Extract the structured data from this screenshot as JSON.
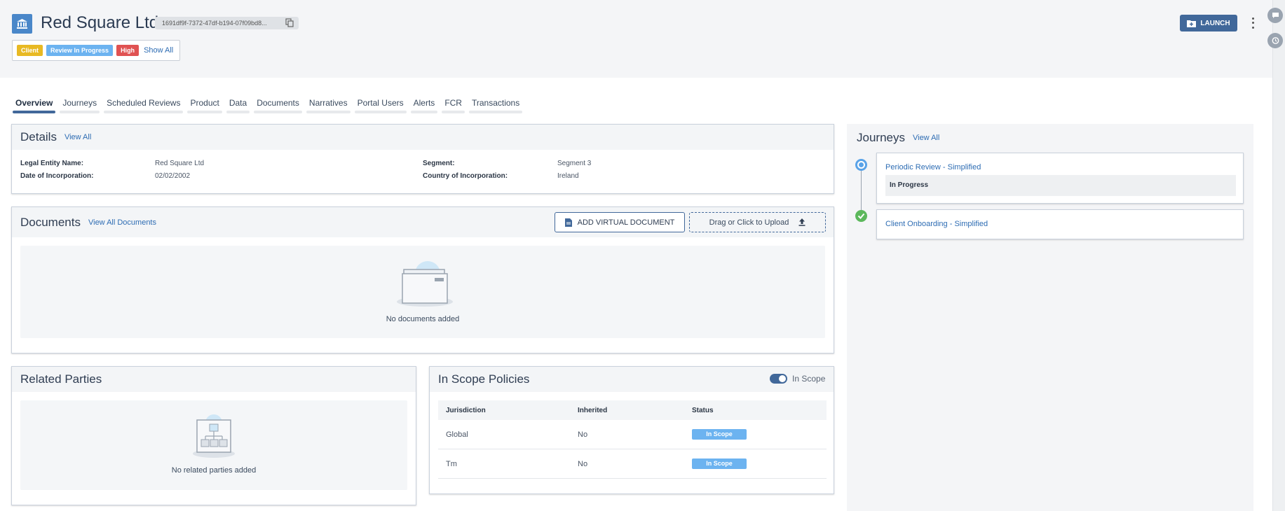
{
  "header": {
    "entity_name": "Red Square Ltd",
    "entity_id": "1691df9f-7372-47df-b194-07f09bd8...",
    "tags": [
      {
        "label": "Client",
        "color": "#e8b923"
      },
      {
        "label": "Review In Progress",
        "color": "#6cb3f0"
      },
      {
        "label": "High",
        "color": "#e05252"
      }
    ],
    "show_all": "Show All",
    "launch_label": "LAUNCH"
  },
  "tabs": [
    "Overview",
    "Journeys",
    "Scheduled Reviews",
    "Product",
    "Data",
    "Documents",
    "Narratives",
    "Portal Users",
    "Alerts",
    "FCR",
    "Transactions"
  ],
  "details": {
    "title": "Details",
    "view_all": "View All",
    "legal_entity_name_label": "Legal Entity Name:",
    "legal_entity_name": "Red Square Ltd",
    "date_of_incorporation_label": "Date of Incorporation:",
    "date_of_incorporation": "02/02/2002",
    "segment_label": "Segment:",
    "segment": "Segment 3",
    "country_label": "Country of Incorporation:",
    "country": "Ireland"
  },
  "documents": {
    "title": "Documents",
    "view_all": "View All Documents",
    "add_virtual": "ADD VIRTUAL DOCUMENT",
    "upload": "Drag or Click to Upload",
    "empty": "No documents added"
  },
  "related_parties": {
    "title": "Related Parties",
    "empty": "No related parties added"
  },
  "policies": {
    "title": "In Scope Policies",
    "toggle_label": "In Scope",
    "columns": [
      "Jurisdiction",
      "Inherited",
      "Status"
    ],
    "rows": [
      {
        "jurisdiction": "Global",
        "inherited": "No",
        "status": "In Scope"
      },
      {
        "jurisdiction": "Tm",
        "inherited": "No",
        "status": "In Scope"
      }
    ]
  },
  "journeys": {
    "title": "Journeys",
    "view_all": "View All",
    "items": [
      {
        "name": "Periodic Review - Simplified",
        "status": "In Progress",
        "state": "in-progress"
      },
      {
        "name": "Client Onboarding - Simplified",
        "state": "complete"
      }
    ]
  },
  "colors": {
    "accent": "#41689a",
    "link": "#2d6cb3",
    "in_progress": "#5aa3e8",
    "complete": "#5cb85c"
  }
}
